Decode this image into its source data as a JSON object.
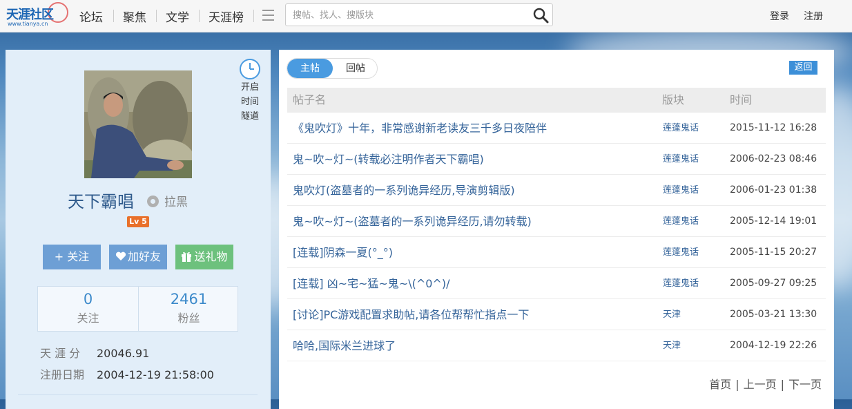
{
  "logo": {
    "text": "天涯社区",
    "url_text": "www.tianya.cn"
  },
  "nav": [
    "论坛",
    "聚焦",
    "文学",
    "天涯榜"
  ],
  "search": {
    "placeholder": "搜帖、找人、搜版块"
  },
  "top_links": {
    "login": "登录",
    "register": "注册"
  },
  "profile": {
    "clock_lines": [
      "开启",
      "时间",
      "隧道"
    ],
    "username": "天下霸唱",
    "blacklist": "拉黑",
    "level": "Lv 5",
    "buttons": {
      "follow": "+ 关注",
      "add_friend": "加好友",
      "gift": "送礼物"
    },
    "stats": [
      {
        "value": "0",
        "label": "关注"
      },
      {
        "value": "2461",
        "label": "粉丝"
      }
    ],
    "info": [
      {
        "key": "天 涯 分",
        "value": "20046.91"
      },
      {
        "key": "注册日期",
        "value": "2004-12-19 21:58:00"
      }
    ]
  },
  "tabs": {
    "main": "主帖",
    "reply": "回帖"
  },
  "back_label": "返回",
  "table": {
    "headers": {
      "title": "帖子名",
      "board": "版块",
      "time": "时间"
    },
    "rows": [
      {
        "title": "《鬼吹灯》十年，非常感谢新老读友三千多日夜陪伴",
        "board": "莲蓬鬼话",
        "time": "2015-11-12 16:28"
      },
      {
        "title": "鬼~吹~灯~(转载必注明作者天下霸唱)",
        "board": "莲蓬鬼话",
        "time": "2006-02-23 08:46"
      },
      {
        "title": "鬼吹灯(盗墓者的一系列诡异经历,导演剪辑版)",
        "board": "莲蓬鬼话",
        "time": "2006-01-23 01:38"
      },
      {
        "title": "鬼~吹~灯~(盗墓者的一系列诡异经历,请勿转载)",
        "board": "莲蓬鬼话",
        "time": "2005-12-14 19:01"
      },
      {
        "title": "[连载]阴森一夏(°_°)",
        "board": "莲蓬鬼话",
        "time": "2005-11-15 20:27"
      },
      {
        "title": "[连载] 凶~宅~猛~鬼~\\(^0^)/",
        "board": "莲蓬鬼话",
        "time": "2005-09-27 09:25"
      },
      {
        "title": "[讨论]PC游戏配置求助帖,请各位帮帮忙指点一下",
        "board": "天津",
        "time": "2005-03-21 13:30"
      },
      {
        "title": "哈哈,国际米兰进球了",
        "board": "天津",
        "time": "2004-12-19 22:26"
      }
    ]
  },
  "pager": {
    "first": "首页",
    "prev": "上一页",
    "next": "下一页"
  },
  "colors": {
    "accent": "#4a9be0",
    "link": "#35649a",
    "gift": "#6dc17d",
    "level": "#e9702b"
  }
}
